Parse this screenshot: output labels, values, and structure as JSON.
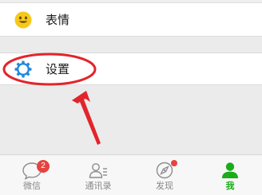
{
  "menu": {
    "stickers": {
      "label": "表情",
      "icon": "smiley-icon"
    },
    "settings": {
      "label": "设置",
      "icon": "gear-icon"
    }
  },
  "tabbar": {
    "tabs": [
      {
        "label": "微信",
        "icon": "chat-bubble-icon",
        "badge": "2"
      },
      {
        "label": "通讯录",
        "icon": "contacts-icon"
      },
      {
        "label": "发现",
        "icon": "compass-icon",
        "dot": true
      },
      {
        "label": "我",
        "icon": "person-icon",
        "active": true
      }
    ]
  },
  "colors": {
    "accent_green": "#1aad19",
    "badge_red": "#e64340",
    "annotation_red": "#e3242b",
    "gear_blue": "#1f8ad8",
    "smiley_yellow": "#f7c81c"
  }
}
